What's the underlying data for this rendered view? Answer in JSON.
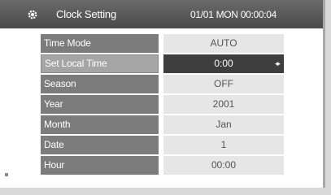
{
  "header": {
    "title": "Clock Setting",
    "status": "01/01 MON  00:00:04",
    "icon": "gear-icon"
  },
  "settings": [
    {
      "label": "Time Mode",
      "value": "AUTO",
      "selected": false
    },
    {
      "label": "Set Local Time",
      "value": "0:00",
      "selected": true,
      "arrows": "◂▸"
    },
    {
      "label": "Season",
      "value": "OFF",
      "selected": false
    },
    {
      "label": "Year",
      "value": "2001",
      "selected": false
    },
    {
      "label": "Month",
      "value": "Jan",
      "selected": false
    },
    {
      "label": "Date",
      "value": "1",
      "selected": false
    },
    {
      "label": "Hour",
      "value": "00:00",
      "selected": false
    }
  ]
}
